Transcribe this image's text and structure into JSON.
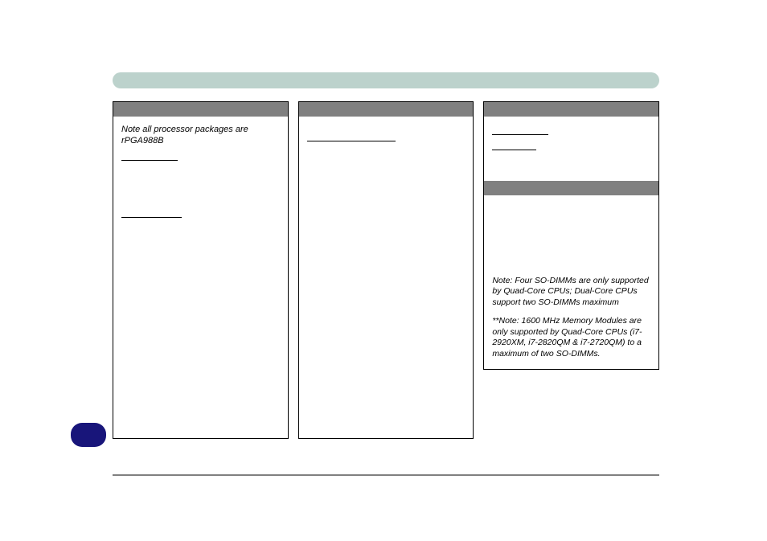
{
  "colors": {
    "topBar": "#bcd2cc",
    "grayHeader": "#808080",
    "badge": "#18157a"
  },
  "col1": {
    "note": "Note all processor packages are rPGA988B"
  },
  "col3": {
    "note1": "  Note: Four SO-DIMMs are only supported by Quad-Core CPUs; Dual-Core CPUs support two SO-DIMMs maximum",
    "note2": "**Note: 1600 MHz Memory Modules are only supported by Quad-Core CPUs (i7-2920XM, i7-2820QM & i7-2720QM) to a maximum of two SO-DIMMs."
  }
}
